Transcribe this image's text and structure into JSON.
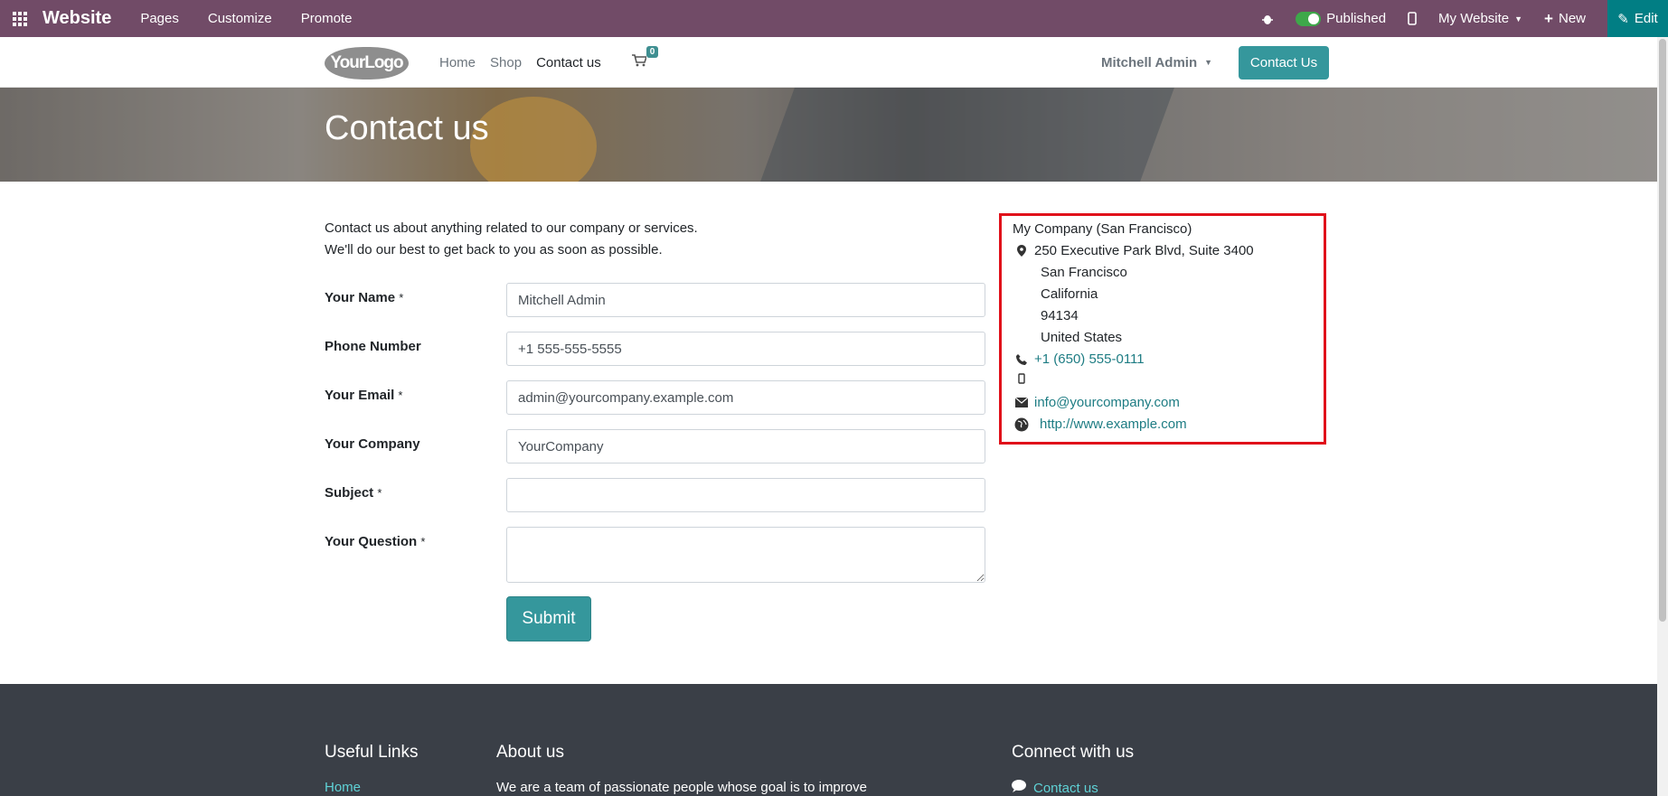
{
  "topbar": {
    "app_name": "Website",
    "menus": [
      "Pages",
      "Customize",
      "Promote"
    ],
    "published_label": "Published",
    "website_label": "My Website",
    "new_label": "New",
    "edit_label": "Edit",
    "bg_color": "#714B67"
  },
  "nav": {
    "logo_text": "YourLogo",
    "links": [
      "Home",
      "Shop",
      "Contact us"
    ],
    "active_link": "Contact us",
    "cart_count": "0",
    "user_name": "Mitchell Admin",
    "contact_button": "Contact Us"
  },
  "banner": {
    "title": "Contact us"
  },
  "form": {
    "intro_line1": "Contact us about anything related to our company or services.",
    "intro_line2": "We'll do our best to get back to you as soon as possible.",
    "fields": [
      {
        "label": "Your Name",
        "required": "*",
        "value": "Mitchell Admin"
      },
      {
        "label": "Phone Number",
        "required": "",
        "value": "+1 555-555-5555"
      },
      {
        "label": "Your Email",
        "required": "*",
        "value": "admin@yourcompany.example.com"
      },
      {
        "label": "Your Company",
        "required": "",
        "value": "YourCompany"
      },
      {
        "label": "Subject",
        "required": "*",
        "value": ""
      },
      {
        "label": "Your Question",
        "required": "*",
        "value": ""
      }
    ],
    "submit_label": "Submit"
  },
  "company": {
    "name": "My Company (San Francisco)",
    "street": "250 Executive Park Blvd, Suite 3400",
    "city": "San Francisco",
    "state": "California",
    "zip": "94134",
    "country": "United States",
    "phone": "+1 (650) 555-0111",
    "email": "info@yourcompany.com",
    "website": "http://www.example.com"
  },
  "footer": {
    "useful_links_title": "Useful Links",
    "about_title": "About us",
    "connect_title": "Connect with us",
    "home_link": "Home",
    "about_text": "We are a team of passionate people whose goal is to improve",
    "contact_link": "Contact us"
  }
}
